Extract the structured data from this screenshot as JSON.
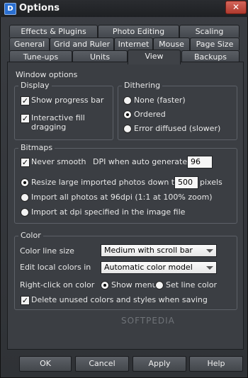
{
  "window": {
    "title": "Options",
    "app_icon": "D",
    "close_glyph": "✕"
  },
  "tabs": {
    "row1": [
      "Effects & Plugins",
      "Photo Editing",
      "Scaling"
    ],
    "row2": [
      "General",
      "Grid and Ruler",
      "Internet",
      "Mouse",
      "Page Size"
    ],
    "row3": [
      "Tune-ups",
      "Units",
      "View",
      "Backups"
    ],
    "active": "View"
  },
  "window_options": {
    "heading": "Window options",
    "display": {
      "legend": "Display",
      "show_progress_bar": {
        "label": "Show progress bar",
        "checked": true
      },
      "interactive_fill": {
        "label_line1": "Interactive fill",
        "label_line2": "dragging",
        "checked": true
      }
    },
    "dithering": {
      "legend": "Dithering",
      "options": [
        "None (faster)",
        "Ordered",
        "Error diffused (slower)"
      ],
      "selected": "Ordered"
    }
  },
  "bitmaps": {
    "legend": "Bitmaps",
    "never_smooth": {
      "label": "Never smooth",
      "checked": true
    },
    "dpi_label": "DPI when auto generated",
    "dpi_value": "96",
    "resize_label": "Resize large imported photos down to",
    "resize_value": "500",
    "resize_unit": "pixels",
    "import_96": "Import all photos at 96dpi (1:1 at 100% zoom)",
    "import_file": "Import at dpi specified in the image file",
    "selected": "Resize large imported photos down to"
  },
  "color": {
    "legend": "Color",
    "color_line_size_label": "Color line size",
    "color_line_size_value": "Medium with scroll bar",
    "edit_local_label": "Edit local colors in",
    "edit_local_value": "Automatic color model",
    "right_click_label": "Right-click on color",
    "right_click_options": [
      "Show menu",
      "Set line color"
    ],
    "right_click_selected": "Show menu",
    "delete_unused": {
      "label": "Delete unused colors and styles when saving",
      "checked": true
    }
  },
  "buttons": {
    "ok": "OK",
    "cancel": "Cancel",
    "apply": "Apply",
    "help": "Help"
  },
  "watermark": "SOFTPEDIA"
}
